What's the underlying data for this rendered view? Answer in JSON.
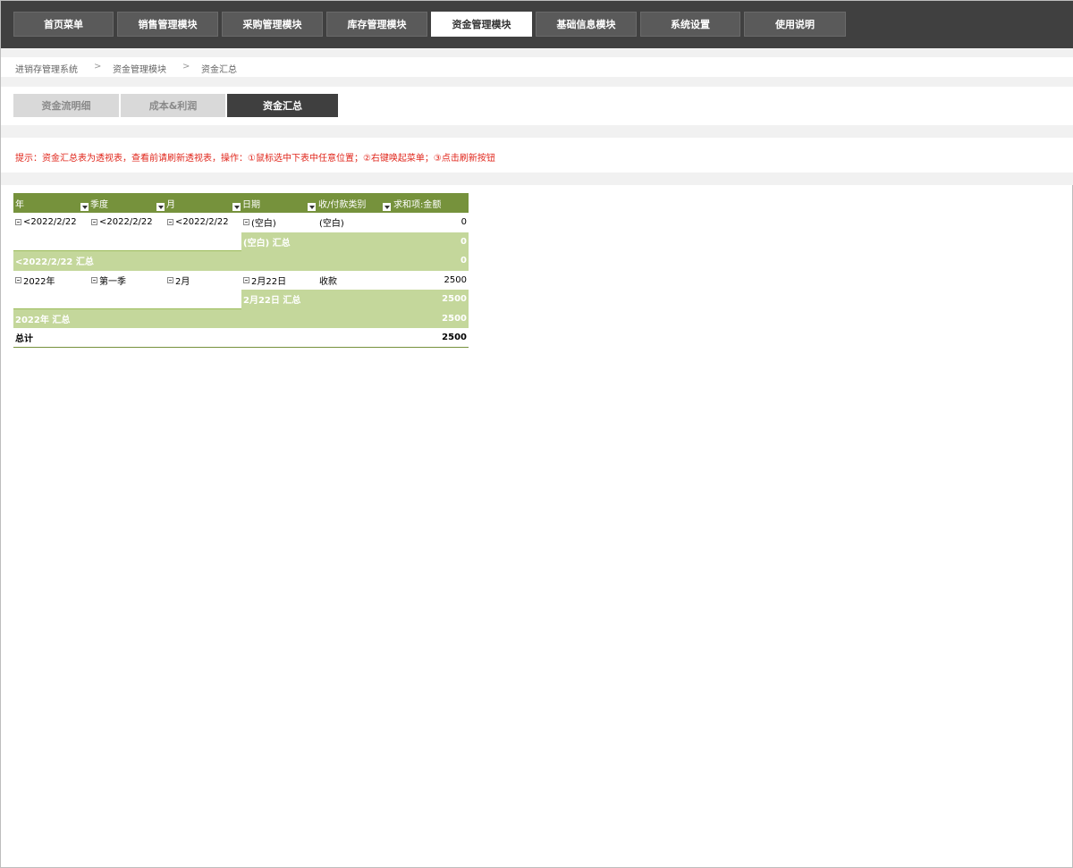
{
  "topnav": {
    "items": [
      {
        "label": "首页菜单",
        "active": false
      },
      {
        "label": "销售管理模块",
        "active": false
      },
      {
        "label": "采购管理模块",
        "active": false
      },
      {
        "label": "库存管理模块",
        "active": false
      },
      {
        "label": "资金管理模块",
        "active": true
      },
      {
        "label": "基础信息模块",
        "active": false
      },
      {
        "label": "系统设置",
        "active": false
      },
      {
        "label": "使用说明",
        "active": false
      }
    ]
  },
  "breadcrumb": {
    "items": [
      "进销存管理系统",
      "资金管理模块",
      "资金汇总"
    ],
    "separator": ">"
  },
  "subtabs": {
    "items": [
      {
        "label": "资金流明细",
        "active": false
      },
      {
        "label": "成本&利润",
        "active": false
      },
      {
        "label": "资金汇总",
        "active": true
      }
    ]
  },
  "notice": {
    "text": "提示：资金汇总表为透视表，查看前请刷新透视表，操作：①鼠标选中下表中任意位置；②右键唤起菜单；③点击刷新按钮"
  },
  "pivot": {
    "headers": [
      "年",
      "季度",
      "月",
      "日期",
      "收/付款类别",
      "求和项:金额"
    ],
    "rows": [
      {
        "type": "detail",
        "year": "<2022/2/22",
        "quarter": "<2022/2/22",
        "month": "<2022/2/22",
        "date": "(空白)",
        "category": "(空白)",
        "amount": "0"
      },
      {
        "type": "date-subtotal",
        "label": "(空白) 汇总",
        "amount": "0"
      },
      {
        "type": "year-subtotal",
        "label": "<2022/2/22 汇总",
        "amount": "0"
      },
      {
        "type": "detail",
        "year": "2022年",
        "quarter": "第一季",
        "month": "2月",
        "date": "2月22日",
        "category": "收款",
        "amount": "2500"
      },
      {
        "type": "date-subtotal",
        "label": "2月22日 汇总",
        "amount": "2500"
      },
      {
        "type": "year-subtotal",
        "label": "2022年 汇总",
        "amount": "2500"
      },
      {
        "type": "total",
        "label": "总计",
        "amount": "2500"
      }
    ]
  },
  "colors": {
    "nav_bg": "#404040",
    "header_green": "#76923c",
    "subtotal_green": "#c4d79b",
    "notice_red": "#e0261b"
  }
}
